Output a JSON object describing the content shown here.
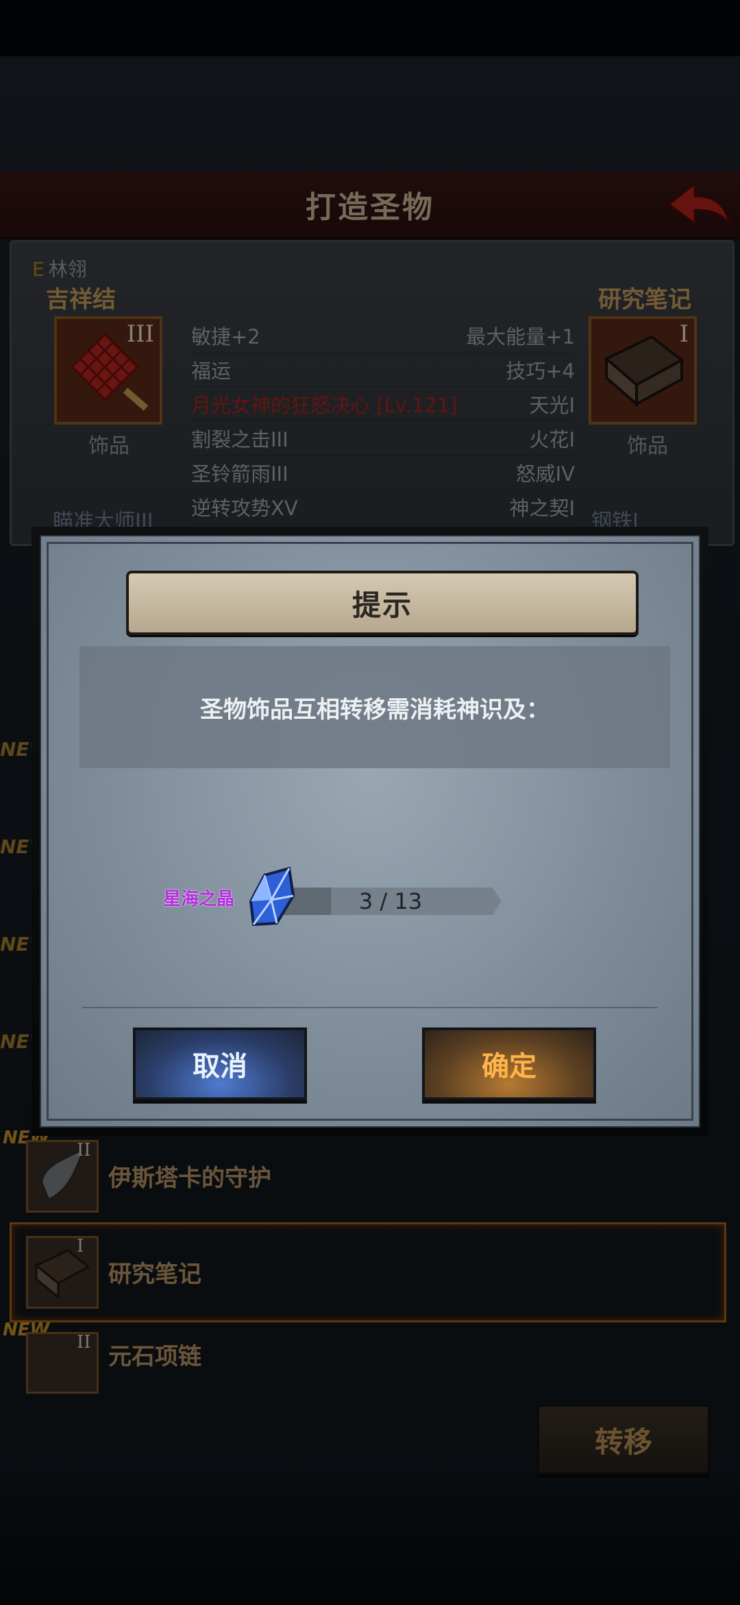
{
  "title_bar": {
    "title": "打造圣物"
  },
  "character": {
    "rank": "E",
    "name": "林翎"
  },
  "left_item": {
    "name": "吉祥结",
    "tier": "III",
    "type": "饰品",
    "footer": "瞄准大师III"
  },
  "right_item": {
    "name": "研究笔记",
    "tier": "I",
    "type": "饰品",
    "footer": "钢铁I"
  },
  "stats": [
    {
      "left": "敏捷+2",
      "right": "最大能量+1"
    },
    {
      "left": "福运",
      "right": "技巧+4"
    },
    {
      "left": "月光女神的狂怒决心 [Lv.121]",
      "right": "天光I"
    },
    {
      "left": "割裂之击III",
      "right": "火花I"
    },
    {
      "left": "圣铃箭雨III",
      "right": "怒威IV"
    },
    {
      "left": "逆转攻势XV",
      "right": "神之契I"
    }
  ],
  "side_new_tags": [
    "NEW",
    "NEW",
    "NEW",
    "NEW"
  ],
  "list": [
    {
      "new": "NEW",
      "tier": "II",
      "label": "伊斯塔卡的守护"
    },
    {
      "new": "",
      "tier": "I",
      "label": "研究笔记"
    },
    {
      "new": "NEW",
      "tier": "II",
      "label": "元石项链"
    }
  ],
  "transfer_button": "转移",
  "modal": {
    "title": "提示",
    "message": "圣物饰品互相转移需消耗神识及：",
    "cost": {
      "item_name": "星海之晶",
      "have": 3,
      "need": 13,
      "text": "3 / 13"
    },
    "cancel": "取消",
    "confirm": "确定"
  },
  "colors": {
    "accent_cancel": "#4e7bd0",
    "accent_confirm": "#ffb44a",
    "crystal": "#3b6fe0"
  }
}
